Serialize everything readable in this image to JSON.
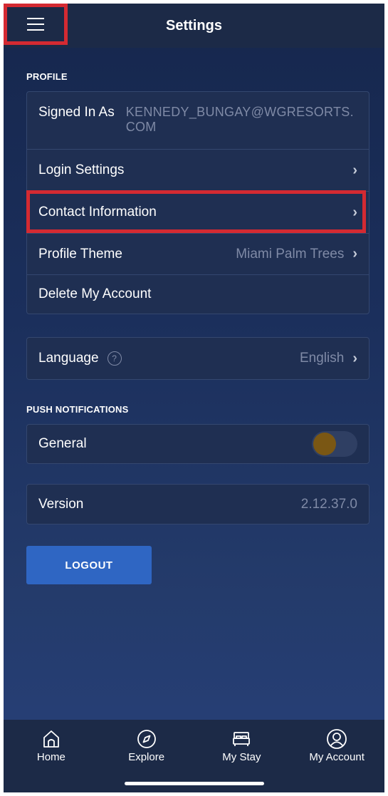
{
  "header": {
    "title": "Settings"
  },
  "profile": {
    "section_label": "PROFILE",
    "signed_in_label": "Signed In As",
    "signed_in_email": "KENNEDY_BUNGAY@WGRESORTS.COM",
    "login_settings_label": "Login Settings",
    "contact_info_label": "Contact Information",
    "profile_theme_label": "Profile Theme",
    "profile_theme_value": "Miami Palm Trees",
    "delete_account_label": "Delete My Account"
  },
  "language": {
    "label": "Language",
    "value": "English",
    "help_glyph": "?"
  },
  "push": {
    "section_label": "PUSH NOTIFICATIONS",
    "general_label": "General",
    "general_enabled": false
  },
  "version": {
    "label": "Version",
    "value": "2.12.37.0"
  },
  "logout": {
    "label": "LOGOUT"
  },
  "tabbar": {
    "items": [
      {
        "label": "Home",
        "icon": "home-icon"
      },
      {
        "label": "Explore",
        "icon": "compass-icon"
      },
      {
        "label": "My Stay",
        "icon": "bed-icon"
      },
      {
        "label": "My Account",
        "icon": "user-circle-icon"
      }
    ]
  },
  "colors": {
    "header_bg": "#1c2a47",
    "highlight": "#d42a32",
    "button": "#2f66c3",
    "toggle_knob": "#7a5714"
  }
}
